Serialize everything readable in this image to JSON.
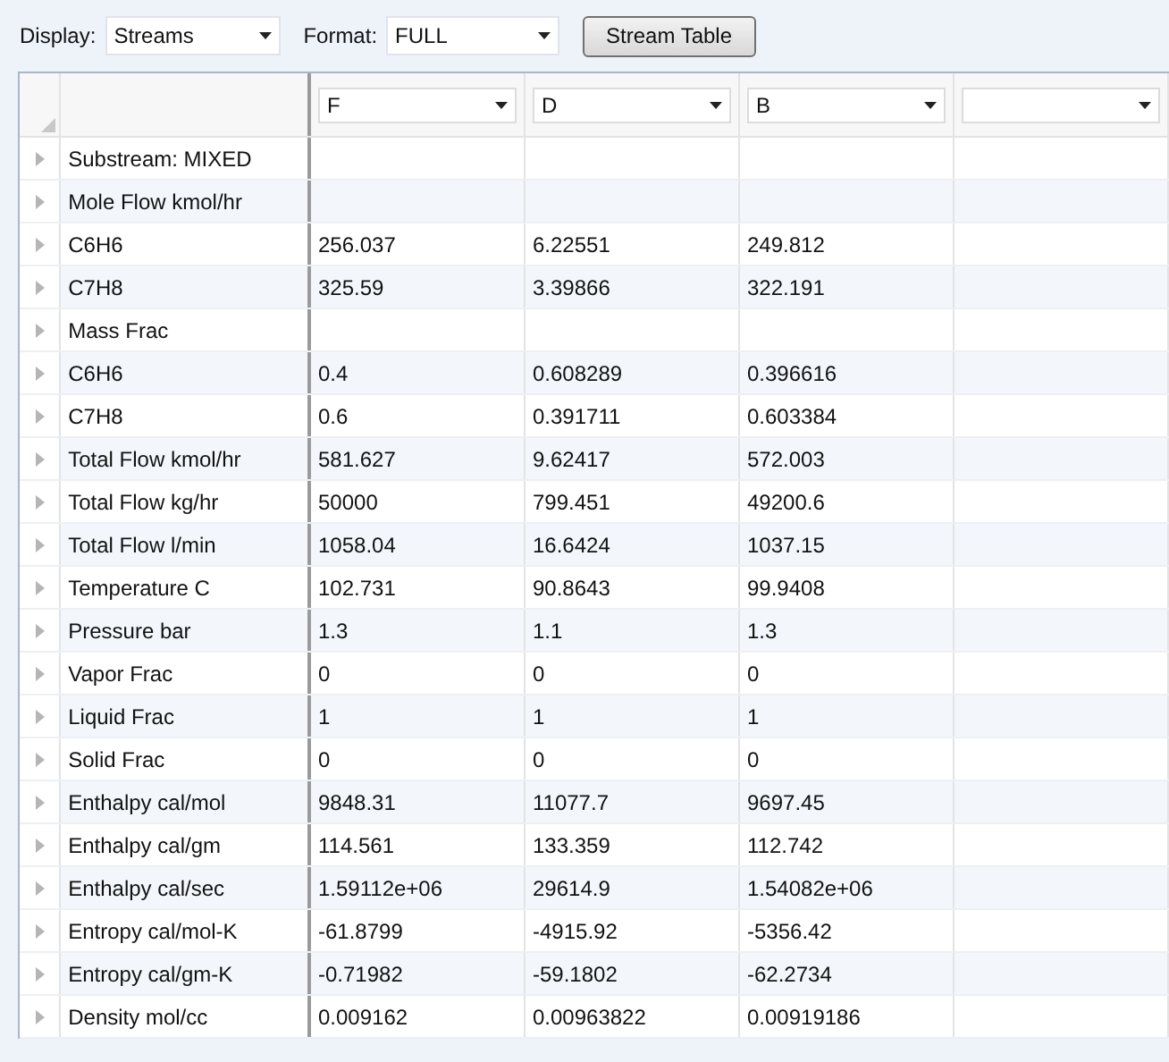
{
  "toolbar": {
    "display_label": "Display:",
    "display_value": "Streams",
    "format_label": "Format:",
    "format_value": "FULL",
    "button": "Stream Table"
  },
  "columns": [
    {
      "stream": "F"
    },
    {
      "stream": "D"
    },
    {
      "stream": "B"
    },
    {}
  ],
  "rows": [
    {
      "label": "Substream: MIXED"
    },
    {
      "label": "Mole Flow kmol/hr"
    },
    {
      "label": "C6H6",
      "values": [
        "256.037",
        "6.22551",
        "249.812"
      ]
    },
    {
      "label": "C7H8",
      "values": [
        "325.59",
        "3.39866",
        "322.191"
      ]
    },
    {
      "label": "Mass Frac"
    },
    {
      "label": "C6H6",
      "values": [
        "0.4",
        "0.608289",
        "0.396616"
      ]
    },
    {
      "label": "C7H8",
      "values": [
        "0.6",
        "0.391711",
        "0.603384"
      ]
    },
    {
      "label": "Total Flow kmol/hr",
      "values": [
        "581.627",
        "9.62417",
        "572.003"
      ]
    },
    {
      "label": "Total Flow kg/hr",
      "values": [
        "50000",
        "799.451",
        "49200.6"
      ]
    },
    {
      "label": "Total Flow l/min",
      "values": [
        "1058.04",
        "16.6424",
        "1037.15"
      ]
    },
    {
      "label": "Temperature C",
      "values": [
        "102.731",
        "90.8643",
        "99.9408"
      ]
    },
    {
      "label": "Pressure bar",
      "values": [
        "1.3",
        "1.1",
        "1.3"
      ]
    },
    {
      "label": "Vapor Frac",
      "values": [
        "0",
        "0",
        "0"
      ]
    },
    {
      "label": "Liquid Frac",
      "values": [
        "1",
        "1",
        "1"
      ]
    },
    {
      "label": "Solid Frac",
      "values": [
        "0",
        "0",
        "0"
      ]
    },
    {
      "label": "Enthalpy cal/mol",
      "values": [
        "9848.31",
        "11077.7",
        "9697.45"
      ]
    },
    {
      "label": "Enthalpy cal/gm",
      "values": [
        "114.561",
        "133.359",
        "112.742"
      ]
    },
    {
      "label": "Enthalpy cal/sec",
      "values": [
        "1.59112e+06",
        "29614.9",
        "1.54082e+06"
      ]
    },
    {
      "label": "Entropy cal/mol-K",
      "values": [
        "-61.8799",
        "-4915.92",
        "-5356.42"
      ]
    },
    {
      "label": "Entropy cal/gm-K",
      "values": [
        "-0.71982",
        "-59.1802",
        "-62.2734"
      ]
    },
    {
      "label": "Density mol/cc",
      "values": [
        "0.009162",
        "0.00963822",
        "0.00919186"
      ]
    }
  ]
}
